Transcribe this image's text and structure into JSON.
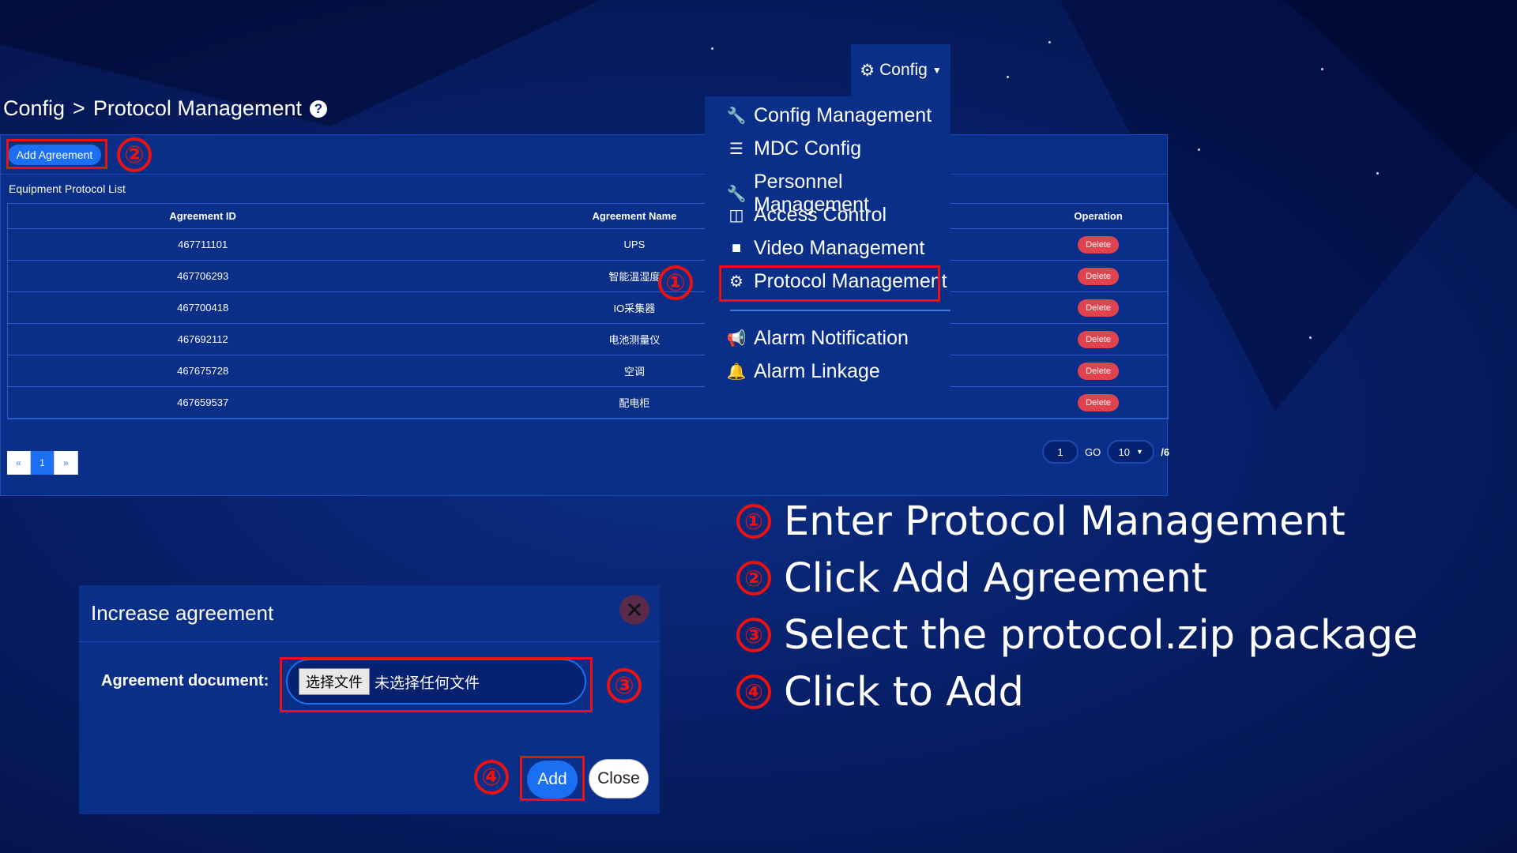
{
  "breadcrumb": {
    "root": "Config",
    "sep": ">",
    "current": "Protocol Management"
  },
  "toolbar": {
    "add_label": "Add Agreement"
  },
  "list": {
    "title": "Equipment Protocol List",
    "headers": {
      "id": "Agreement ID",
      "name": "Agreement Name",
      "operation": "Operation"
    },
    "rows": [
      {
        "id": "467711101",
        "name": "UPS",
        "action": "Delete"
      },
      {
        "id": "467706293",
        "name": "智能温湿度",
        "action": "Delete"
      },
      {
        "id": "467700418",
        "name": "IO采集器",
        "action": "Delete"
      },
      {
        "id": "467692112",
        "name": "电池测量仪",
        "action": "Delete"
      },
      {
        "id": "467675728",
        "name": "空调",
        "action": "Delete"
      },
      {
        "id": "467659537",
        "name": "配电柜",
        "action": "Delete"
      }
    ]
  },
  "pagination": {
    "prev": "«",
    "current": "1",
    "next": "»",
    "page_input": "1",
    "go": "GO",
    "page_size": "10",
    "total": "/6"
  },
  "config_menu": {
    "label": "Config",
    "items": [
      {
        "label": "Config Management",
        "icon": "wrench-icon"
      },
      {
        "label": "MDC Config",
        "icon": "list-icon"
      },
      {
        "label": "Personnel Management",
        "icon": "wrench-icon"
      },
      {
        "label": "Access Control",
        "icon": "columns-icon"
      },
      {
        "label": "Video Management",
        "icon": "video-icon"
      },
      {
        "label": "Protocol Management",
        "icon": "cogs-icon"
      },
      {
        "label": "Alarm Notification",
        "icon": "bullhorn-icon"
      },
      {
        "label": "Alarm Linkage",
        "icon": "bell-icon"
      }
    ]
  },
  "modal": {
    "title": "Increase agreement",
    "doc_label": "Agreement document:",
    "file_button": "选择文件",
    "file_status": "未选择任何文件",
    "add_label": "Add",
    "close_label": "Close"
  },
  "annotations": [
    "①",
    "②",
    "③",
    "④"
  ],
  "steps": [
    {
      "num": "①",
      "text": "Enter Protocol Management"
    },
    {
      "num": "②",
      "text": "Click Add Agreement"
    },
    {
      "num": "③",
      "text": "Select the protocol.zip package"
    },
    {
      "num": "④",
      "text": "Click to Add"
    }
  ],
  "colors": {
    "accent": "#1b6ff2",
    "danger": "#e0424e",
    "annotation": "#ee1111",
    "panel": "#0a2f88"
  }
}
